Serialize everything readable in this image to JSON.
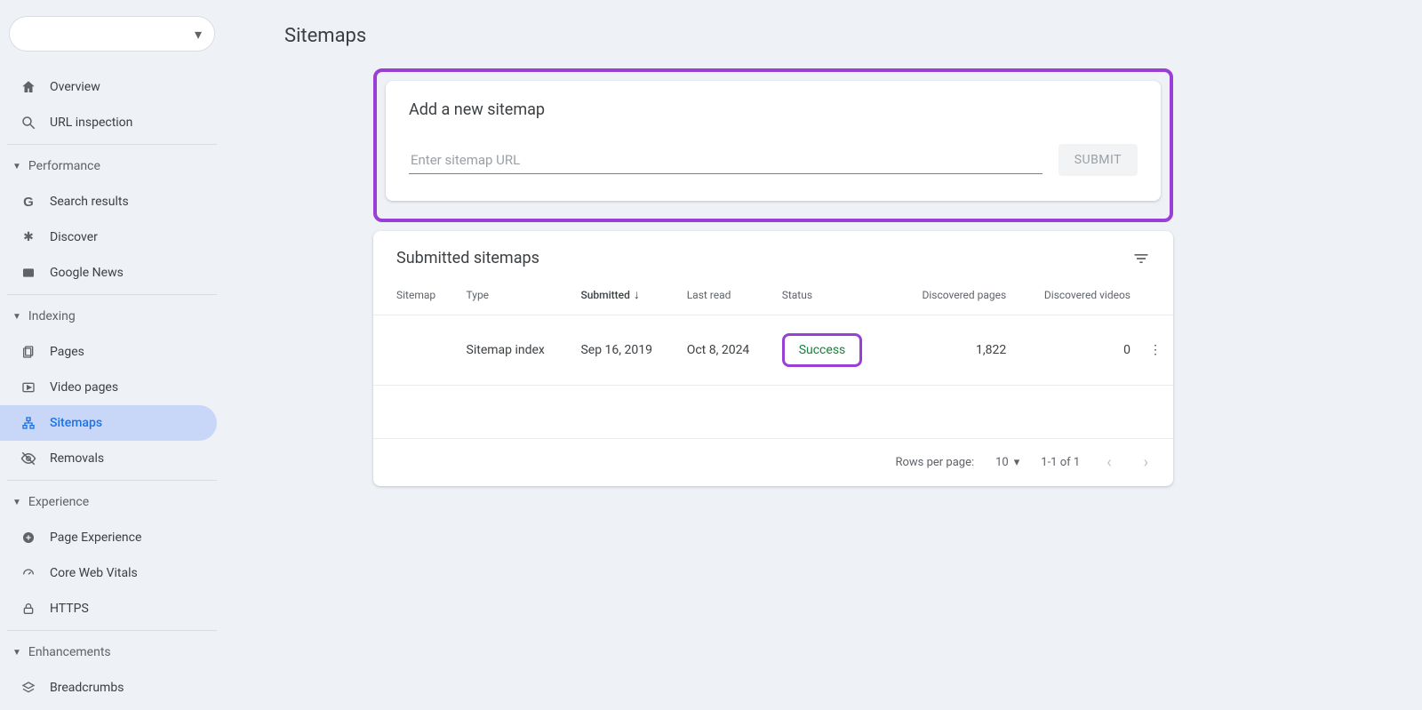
{
  "page": {
    "title": "Sitemaps"
  },
  "sidebar": {
    "top": [
      {
        "label": "Overview",
        "icon": "home"
      },
      {
        "label": "URL inspection",
        "icon": "search"
      }
    ],
    "sections": [
      {
        "label": "Performance",
        "items": [
          {
            "label": "Search results",
            "icon": "g"
          },
          {
            "label": "Discover",
            "icon": "star"
          },
          {
            "label": "Google News",
            "icon": "news"
          }
        ]
      },
      {
        "label": "Indexing",
        "items": [
          {
            "label": "Pages",
            "icon": "pages"
          },
          {
            "label": "Video pages",
            "icon": "video"
          },
          {
            "label": "Sitemaps",
            "icon": "sitemap",
            "active": true
          },
          {
            "label": "Removals",
            "icon": "eye-off"
          }
        ]
      },
      {
        "label": "Experience",
        "items": [
          {
            "label": "Page Experience",
            "icon": "circle-plus"
          },
          {
            "label": "Core Web Vitals",
            "icon": "speed"
          },
          {
            "label": "HTTPS",
            "icon": "lock"
          }
        ]
      },
      {
        "label": "Enhancements",
        "items": [
          {
            "label": "Breadcrumbs",
            "icon": "layers"
          }
        ]
      }
    ]
  },
  "add_card": {
    "title": "Add a new sitemap",
    "placeholder": "Enter sitemap URL",
    "submit": "SUBMIT"
  },
  "submitted": {
    "title": "Submitted sitemaps",
    "headers": {
      "sitemap": "Sitemap",
      "type": "Type",
      "submitted": "Submitted",
      "last_read": "Last read",
      "status": "Status",
      "pages": "Discovered pages",
      "videos": "Discovered videos"
    },
    "rows": [
      {
        "sitemap": "",
        "type": "Sitemap index",
        "submitted": "Sep 16, 2019",
        "last_read": "Oct 8, 2024",
        "status": "Success",
        "pages": "1,822",
        "videos": "0"
      }
    ],
    "pager": {
      "rows_per_page_label": "Rows per page:",
      "rows_per_page_value": "10",
      "range": "1-1 of 1"
    }
  }
}
